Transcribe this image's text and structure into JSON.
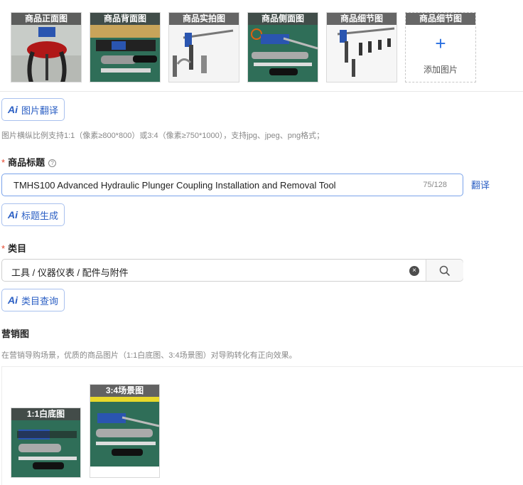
{
  "product_images": [
    {
      "caption": "商品正面图"
    },
    {
      "caption": "商品背面图"
    },
    {
      "caption": "商品实拍图"
    },
    {
      "caption": "商品侧面图"
    },
    {
      "caption": "商品细节图"
    }
  ],
  "add_slot": {
    "caption": "商品细节图",
    "plus": "+",
    "label": "添加图片"
  },
  "image_translate_button": {
    "ai": "Ai",
    "label": "图片翻译"
  },
  "image_hint": "图片横纵比例支持1:1（像素≥800*800）或3:4（像素≥750*1000），支持jpg、jpeg、png格式；",
  "title_field": {
    "required_mark": "*",
    "label": "商品标题",
    "help_icon": "?",
    "value": "TMHS100 Advanced Hydraulic Plunger Coupling Installation and Removal Tool",
    "counter": "75/128",
    "translate_link": "翻译"
  },
  "title_generate_button": {
    "ai": "Ai",
    "label": "标题生成"
  },
  "category_field": {
    "required_mark": "*",
    "label": "类目",
    "value": "工具 / 仪器仪表 / 配件与附件",
    "clear_icon": "×"
  },
  "category_query_button": {
    "ai": "Ai",
    "label": "类目查询"
  },
  "marketing": {
    "label": "营销图",
    "hint": "在营销导购场景，优质的商品图片（1:1白底图、3:4场景图）对导购转化有正向效果。",
    "images": [
      {
        "caption": "1:1白底图"
      },
      {
        "caption": "3:4场景图"
      }
    ]
  },
  "colors": {
    "accent": "#2b5fc4",
    "required": "#e5452b",
    "input_focus_border": "#7aa3ea"
  }
}
